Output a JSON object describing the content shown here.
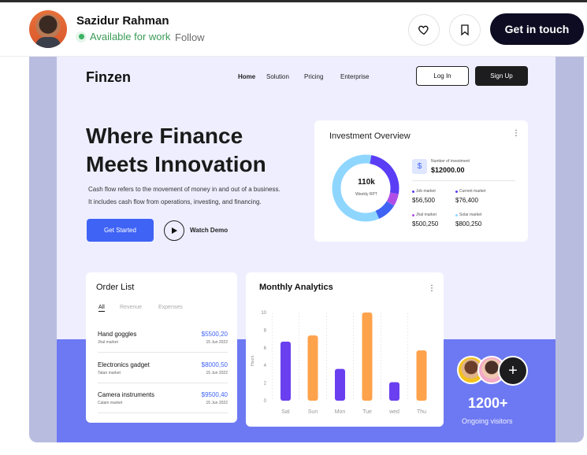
{
  "header": {
    "author_name": "Sazidur Rahman",
    "availability": "Available for work",
    "follow": "Follow",
    "cta": "Get in touch",
    "like_icon": "heart-icon",
    "save_icon": "bookmark-icon",
    "accent": "#0d0c22"
  },
  "shot": {
    "logo": "Finzen",
    "nav": [
      "Home",
      "Solution",
      "Pricing",
      "Enterprise"
    ],
    "login": "Log In",
    "signup": "Sign Up",
    "hero_line1": "Where Finance",
    "hero_line2": "Meets Innovation",
    "hero_sub1": "Cash flow refers to the movement of money in and out of a business.",
    "hero_sub2": "It includes cash flow from operations, investing, and financing.",
    "get_started": "Get Started",
    "watch_demo": "Watch Demo",
    "investment": {
      "title": "Investment Overview",
      "donut_value": "110k",
      "donut_label": "Weekly RPT",
      "number_label": "Number of investment",
      "number_value": "$12000.00",
      "markets": [
        {
          "label": "Job market",
          "value": "$56,500",
          "color": "#5b3df5"
        },
        {
          "label": "Current market",
          "value": "$76,400",
          "color": "#5b3df5"
        },
        {
          "label": "Jhal market",
          "value": "$500,250",
          "color": "#b04ee6"
        },
        {
          "label": "Solar market",
          "value": "$800,250",
          "color": "#8fd6ff"
        }
      ]
    },
    "orders": {
      "title": "Order List",
      "tabs": [
        "All",
        "Revenue",
        "Expenses"
      ],
      "rows": [
        {
          "name": "Hand goggles",
          "market": "Jhal market",
          "amount": "$5500,20",
          "date": "15 Jun 2022"
        },
        {
          "name": "Electronics gadget",
          "market": "Tatan market",
          "amount": "$8000,50",
          "date": "15 Jun 2022"
        },
        {
          "name": "Camera instruments",
          "market": "Calam market",
          "amount": "$9500,40",
          "date": "15 Jun 2022"
        }
      ]
    },
    "analytics": {
      "title": "Monthly Analytics"
    },
    "visitors": {
      "count": "1200+",
      "label": "Ongoing visitors"
    }
  },
  "chart_data": {
    "type": "bar",
    "title": "Monthly Analytics",
    "ylabel": "Hours",
    "xlabel": "",
    "categories": [
      "Sat",
      "Sun",
      "Mon",
      "Tue",
      "wed",
      "Thu"
    ],
    "values": [
      6.7,
      7.4,
      3.6,
      10,
      2.1,
      5.7
    ],
    "colors": [
      "#6a3ff0",
      "#ffa24c",
      "#6a3ff0",
      "#ffa24c",
      "#6a3ff0",
      "#ffa24c"
    ],
    "yticks": [
      0,
      2,
      4,
      6,
      8,
      10
    ],
    "ylim": [
      0,
      10
    ],
    "grid": "vertical dashed"
  }
}
